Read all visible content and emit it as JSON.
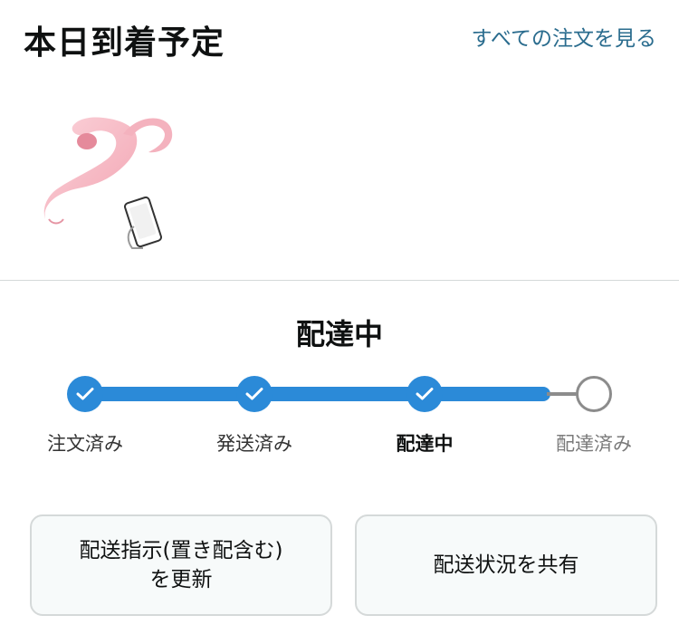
{
  "header": {
    "title": "本日到着予定",
    "view_all_link": "すべての注文を見る"
  },
  "product": {
    "image_icon": "pink-device-product-image"
  },
  "status": {
    "title": "配達中"
  },
  "tracker": {
    "steps": [
      {
        "label": "注文済み",
        "state": "done"
      },
      {
        "label": "発送済み",
        "state": "done"
      },
      {
        "label": "配達中",
        "state": "current"
      },
      {
        "label": "配達済み",
        "state": "pending"
      }
    ],
    "progress_fraction": 0.85
  },
  "actions": {
    "update_delivery_line1": "配送指示(置き配含む)",
    "update_delivery_line2": "を更新",
    "share_status": "配送状況を共有"
  },
  "colors": {
    "accent": "#2b8ad8",
    "link": "#2a6c8e",
    "pending": "#8c8c8c",
    "button_bg": "#f7fafa",
    "button_border": "#d5d9d9"
  }
}
